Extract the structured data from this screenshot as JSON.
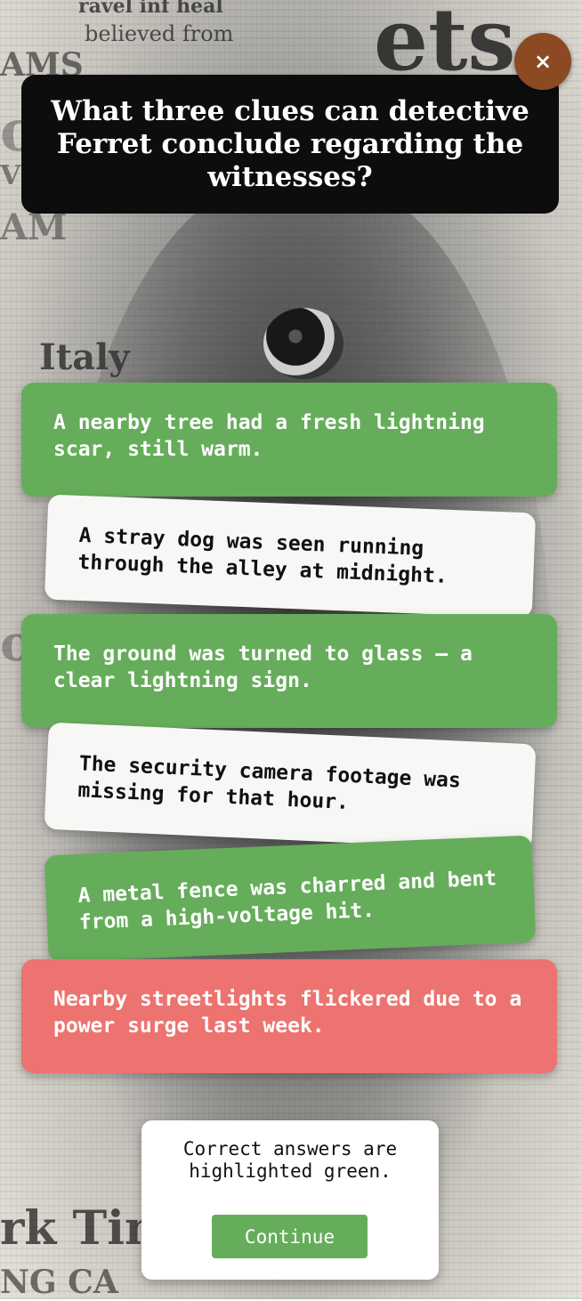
{
  "background": {
    "newsprint": [
      "ravel inf heal",
      "believed from",
      "VIET NA",
      "om",
      "AM",
      "Italy",
      "orl",
      "rk Tin",
      "NG CA",
      "ets",
      "AMS"
    ]
  },
  "close_button": {
    "icon": "close-icon",
    "glyph": "×"
  },
  "question": {
    "text": "What three clues can detective Ferret conclude regarding the witnesses?"
  },
  "answers": [
    {
      "text": "A nearby tree had a fresh lightning scar, still warm.",
      "status": "correct",
      "color": "#66ad5b"
    },
    {
      "text": "A stray dog was seen running through the alley at midnight.",
      "status": "neutral",
      "color": "#f7f7f5"
    },
    {
      "text": "The ground was turned to glass — a clear lightning sign.",
      "status": "correct",
      "color": "#66ad5b"
    },
    {
      "text": "The security camera footage was missing for that hour.",
      "status": "neutral",
      "color": "#f7f7f5"
    },
    {
      "text": "A metal fence was charred and bent from a high-voltage hit.",
      "status": "correct",
      "color": "#66ad5b"
    },
    {
      "text": "Nearby streetlights flickered due to a power surge last week.",
      "status": "incorrect",
      "color": "#ec7370"
    }
  ],
  "result_modal": {
    "message": "Correct answers are highlighted green.",
    "continue_label": "Continue"
  },
  "colors": {
    "close_button": "#8b4a22",
    "question_bg": "#0d0d0d",
    "correct": "#66ad5b",
    "incorrect": "#ec7370"
  }
}
